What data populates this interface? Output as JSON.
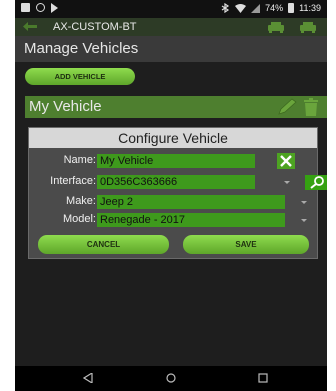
{
  "status_bar": {
    "battery": "74%",
    "time": "11:39"
  },
  "app_bar": {
    "title": "AX-CUSTOM-BT"
  },
  "page": {
    "title": "Manage Vehicles"
  },
  "toolbar": {
    "add_vehicle_label": "ADD VEHICLE"
  },
  "vehicle_list": [
    {
      "name": "My Vehicle"
    }
  ],
  "dialog": {
    "title": "Configure Vehicle",
    "fields": {
      "name": {
        "label": "Name:",
        "value": "My Vehicle"
      },
      "interface": {
        "label": "Interface:",
        "value": "0D356C363666"
      },
      "make": {
        "label": "Make:",
        "value": "Jeep 2"
      },
      "model": {
        "label": "Model:",
        "value": "Renegade - 2017"
      }
    },
    "cancel_label": "CANCEL",
    "save_label": "SAVE"
  },
  "colors": {
    "accent": "#5ea62a",
    "field_bg": "#3e9a1c",
    "row_bg": "#4e7f2f"
  }
}
